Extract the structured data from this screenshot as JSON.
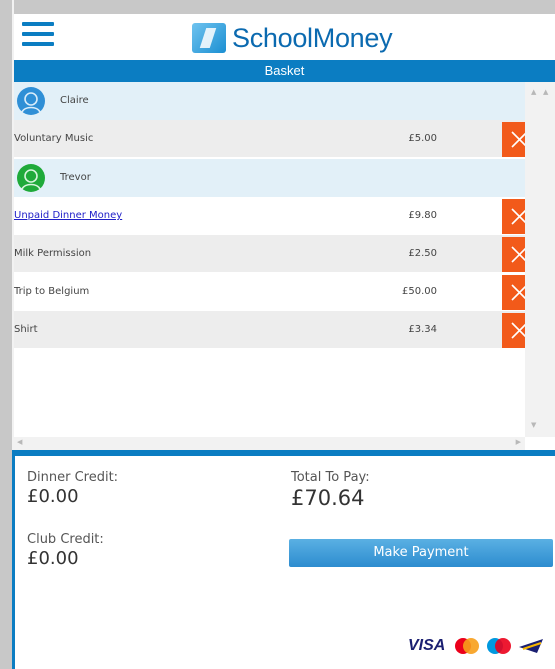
{
  "header": {
    "brand": "SchoolMoney",
    "menu_icon": "hamburger-menu-icon"
  },
  "basket": {
    "title": "Basket",
    "children": [
      {
        "name": "Claire",
        "avatar_color": "#2f8fd6",
        "items": [
          {
            "label": "Voluntary Music",
            "price": "£5.00",
            "link": false
          }
        ]
      },
      {
        "name": "Trevor",
        "avatar_color": "#1faa3a",
        "items": [
          {
            "label": "Unpaid Dinner Money",
            "price": "£9.80",
            "link": true
          },
          {
            "label": "Milk Permission",
            "price": "£2.50",
            "link": false
          },
          {
            "label": "Trip to Belgium",
            "price": "£50.00",
            "link": false
          },
          {
            "label": "Shirt",
            "price": "£3.34",
            "link": false
          }
        ]
      }
    ],
    "remove_icon": "close-x-icon",
    "remove_color": "#f25a1a"
  },
  "summary": {
    "dinner_credit_label": "Dinner Credit:",
    "dinner_credit_value": "£0.00",
    "club_credit_label": "Club Credit:",
    "club_credit_value": "£0.00",
    "total_label": "Total To Pay:",
    "total_value": "£70.64",
    "pay_button": "Make Payment",
    "card_brands": [
      "VISA",
      "Mastercard",
      "Maestro",
      "Delta"
    ]
  },
  "colors": {
    "accent": "#0b7dc2",
    "brand_text": "#0b6ab0"
  }
}
